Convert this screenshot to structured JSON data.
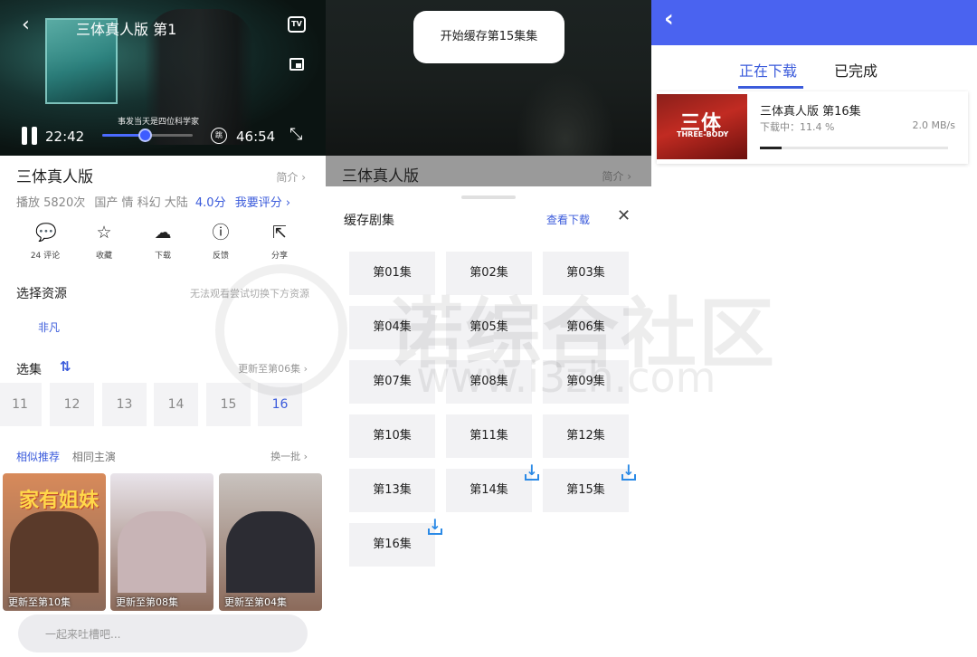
{
  "player": {
    "title": "三体真人版 第1",
    "subtitle": "事发当天是四位科学家",
    "current_time": "22:42",
    "duration": "46:54",
    "progress": 0.47,
    "tv_label": "TV",
    "skip_label": "跳"
  },
  "info": {
    "title": "三体真人版",
    "intro_link": "简介 ›",
    "plays": "播放 5820次",
    "tags": "国产 情 科幻 大陆",
    "score": "4.0分",
    "rate_link": "我要评分 ›"
  },
  "actions": [
    {
      "icon": "comment-icon",
      "glyph": "💬",
      "label": "24 评论"
    },
    {
      "icon": "star-icon",
      "glyph": "☆",
      "label": "收藏"
    },
    {
      "icon": "cloud-download-icon",
      "glyph": "☁",
      "label": "下载"
    },
    {
      "icon": "alert-icon",
      "glyph": "ⓘ",
      "label": "反馈"
    },
    {
      "icon": "share-icon",
      "glyph": "⇱",
      "label": "分享"
    }
  ],
  "source": {
    "title": "选择资源",
    "hint": "无法观看尝试切换下方资源",
    "item": "非凡"
  },
  "episodes": {
    "title": "选集",
    "update": "更新至第06集 ›",
    "items": [
      "11",
      "12",
      "13",
      "14",
      "15",
      "16"
    ],
    "active": "16"
  },
  "recommend": {
    "tab_similar": "相似推荐",
    "tab_cast": "相同主演",
    "more": "换一批 ›",
    "posters": [
      {
        "caption": "更新至第10集",
        "logo": "家有姐妹",
        "color": "#d88a5a"
      },
      {
        "caption": "更新至第08集",
        "logo": "",
        "color": "#e9e4ea"
      },
      {
        "caption": "更新至第04集",
        "logo": "",
        "color": "#c9c3bf"
      }
    ]
  },
  "comment": {
    "placeholder": "一起来吐槽吧..."
  },
  "cache": {
    "toast": "开始缓存第15集集",
    "dim_title": "三体真人版",
    "dim_intro": "简介 ›",
    "sheet_title": "缓存剧集",
    "view_downloads": "查看下载",
    "close": "✕",
    "episodes": [
      {
        "label": "第01集",
        "downloading": false
      },
      {
        "label": "第02集",
        "downloading": false
      },
      {
        "label": "第03集",
        "downloading": false
      },
      {
        "label": "第04集",
        "downloading": false
      },
      {
        "label": "第05集",
        "downloading": false
      },
      {
        "label": "第06集",
        "downloading": false
      },
      {
        "label": "第07集",
        "downloading": false
      },
      {
        "label": "第08集",
        "downloading": false
      },
      {
        "label": "第09集",
        "downloading": false
      },
      {
        "label": "第10集",
        "downloading": false
      },
      {
        "label": "第11集",
        "downloading": false
      },
      {
        "label": "第12集",
        "downloading": false
      },
      {
        "label": "第13集",
        "downloading": false
      },
      {
        "label": "第14集",
        "downloading": true
      },
      {
        "label": "第15集",
        "downloading": true
      },
      {
        "label": "第16集",
        "downloading": true
      }
    ]
  },
  "downloads": {
    "back": "‹",
    "tab_active": "正在下载",
    "tab_done": "已完成",
    "item": {
      "cover_title": "三体",
      "cover_en": "THREE-BODY",
      "name": "三体真人版 第16集",
      "status": "下载中：11.4 %",
      "speed": "2.0 MB/s",
      "progress": 0.114
    },
    "accent": "#4a63f0"
  },
  "watermark": {
    "cn": "诺综合社区",
    "url": "www.i3zh.com"
  }
}
